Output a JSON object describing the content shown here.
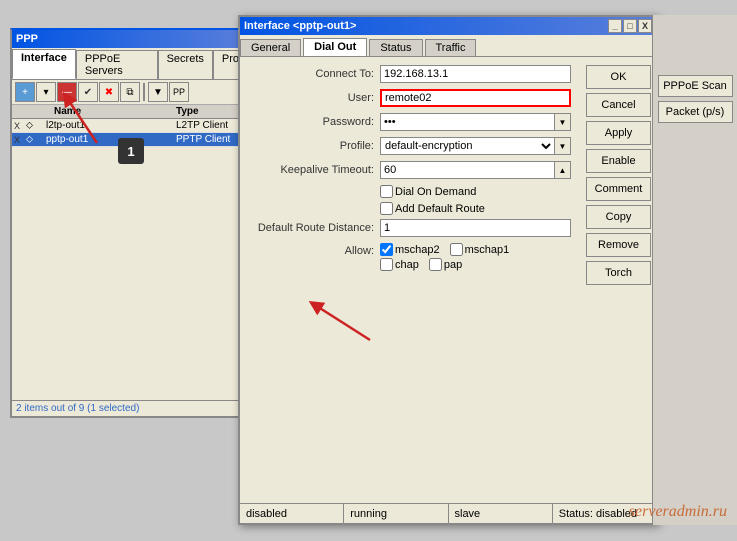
{
  "ppp": {
    "title": "PPP",
    "tabs": [
      {
        "label": "Interface",
        "active": true
      },
      {
        "label": "PPPoE Servers"
      },
      {
        "label": "Secrets"
      },
      {
        "label": "Pro"
      }
    ],
    "table": {
      "headers": [
        "",
        "",
        "Name",
        "Type"
      ],
      "rows": [
        {
          "col1": "X",
          "col2": "",
          "name": "l2tp-out1",
          "type": "L2TP Client",
          "selected": false
        },
        {
          "col1": "X",
          "col2": "",
          "name": "pptp-out1",
          "type": "PPTP Client",
          "selected": true
        }
      ]
    },
    "status": "2 items out of 9 (1 selected)"
  },
  "dialog": {
    "title": "Interface <pptp-out1>",
    "title_btns": [
      "_",
      "□",
      "X"
    ],
    "tabs": [
      {
        "label": "General"
      },
      {
        "label": "Dial Out",
        "active": true
      },
      {
        "label": "Status"
      },
      {
        "label": "Traffic"
      }
    ],
    "form": {
      "connect_to_label": "Connect To:",
      "connect_to_value": "192.168.13.1",
      "user_label": "User:",
      "user_value": "remote02",
      "password_label": "Password:",
      "password_value": "***",
      "profile_label": "Profile:",
      "profile_value": "default-encryption",
      "keepalive_label": "Keepalive Timeout:",
      "keepalive_value": "60",
      "dial_on_demand_label": "Dial On Demand",
      "add_default_route_label": "Add Default Route",
      "default_route_distance_label": "Default Route Distance:",
      "default_route_distance_value": "1",
      "allow_label": "Allow:",
      "checkboxes": {
        "mschap2": {
          "label": "mschap2",
          "checked": true
        },
        "mschap1": {
          "label": "mschap1",
          "checked": false
        },
        "chap": {
          "label": "chap",
          "checked": false
        },
        "pap": {
          "label": "pap",
          "checked": false
        }
      }
    },
    "buttons": [
      "OK",
      "Cancel",
      "Apply",
      "Enable",
      "Comment",
      "Copy",
      "Remove",
      "Torch"
    ],
    "statusbar": [
      "disabled",
      "running",
      "slave",
      "Status: disabled"
    ]
  },
  "right_panel": {
    "buttons": [
      "PPPoE Scan",
      "Packet (p/s)"
    ]
  },
  "watermark": "serveradmin.ru",
  "badge": "1"
}
